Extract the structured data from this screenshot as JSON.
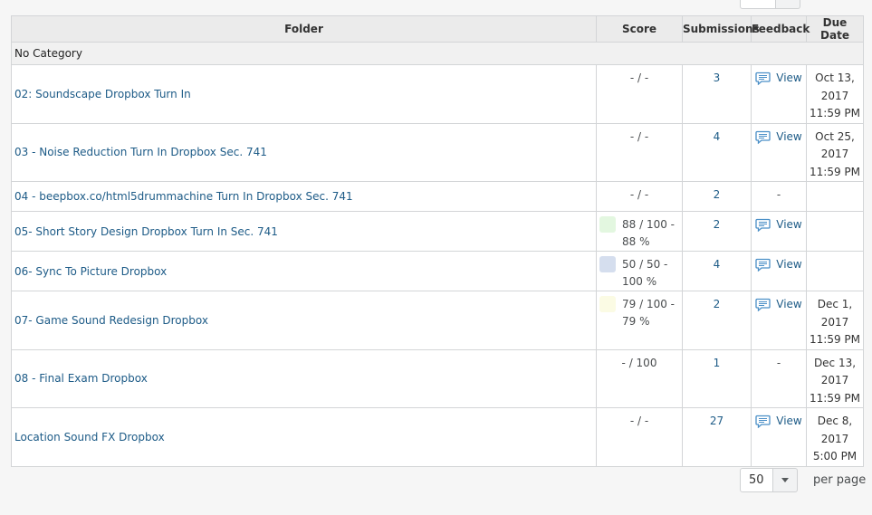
{
  "pager_top": {
    "value": "",
    "label": ""
  },
  "table": {
    "headers": {
      "folder": "Folder",
      "score": "Score",
      "submissions": "Submissions",
      "feedback": "Feedback",
      "due": "Due Date"
    },
    "category": "No Category",
    "rows": [
      {
        "folder": "02: Soundscape Dropbox Turn In",
        "score": "- / -",
        "score_color": "",
        "submissions": "3",
        "feedback": "View",
        "due": [
          "Oct 13,",
          "2017",
          "11:59 PM"
        ]
      },
      {
        "folder": "03 - Noise Reduction Turn In Dropbox Sec. 741",
        "score": "- / -",
        "score_color": "",
        "submissions": "4",
        "feedback": "View",
        "due": [
          "Oct 25,",
          "2017",
          "11:59 PM"
        ]
      },
      {
        "folder": "04 - beepbox.co/html5drummachine Turn In Dropbox Sec. 741",
        "score": "- / -",
        "score_color": "",
        "submissions": "2",
        "feedback": "-",
        "due": []
      },
      {
        "folder": "05- Short Story Design Dropbox Turn In Sec. 741",
        "score": [
          "88 / 100 -",
          "88 %"
        ],
        "score_color": "#e3f7e0",
        "submissions": "2",
        "feedback": "View",
        "due": []
      },
      {
        "folder": "06- Sync To Picture Dropbox",
        "score": [
          "50 / 50 -",
          "100 %"
        ],
        "score_color": "#d5deee",
        "submissions": "4",
        "feedback": "View",
        "due": []
      },
      {
        "folder": "07- Game Sound Redesign Dropbox",
        "score": [
          "79 / 100 -",
          "79 %"
        ],
        "score_color": "#fbfbe4",
        "submissions": "2",
        "feedback": "View",
        "due": [
          "Dec 1,",
          "2017",
          "11:59 PM"
        ]
      },
      {
        "folder": "08 - Final Exam Dropbox",
        "score": "- / 100",
        "score_color": "",
        "submissions": "1",
        "feedback": "-",
        "due": [
          "Dec 13,",
          "2017",
          "11:59 PM"
        ]
      },
      {
        "folder": "Location Sound FX Dropbox",
        "score": "- / -",
        "score_color": "",
        "submissions": "27",
        "feedback": "View",
        "due": [
          "Dec 8,",
          "2017",
          "5:00 PM"
        ]
      }
    ]
  },
  "pager": {
    "value": "50",
    "label": "per page"
  },
  "icons": {
    "feedback": "speech-bubble-icon",
    "dropdown": "triangle-down-icon"
  },
  "colors": {
    "link": "#1d5b87",
    "header_bg": "#ebebeb"
  }
}
